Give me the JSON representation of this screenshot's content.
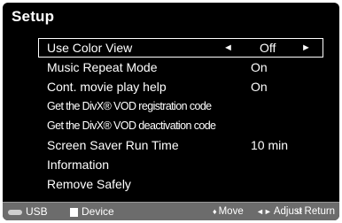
{
  "title": "Setup",
  "menu": [
    {
      "label": "Use Color View",
      "value": "Off"
    },
    {
      "label": "Music Repeat Mode",
      "value": "On"
    },
    {
      "label": "Cont. movie play help",
      "value": "On"
    },
    {
      "label": "Get the DivX® VOD registration code",
      "value": ""
    },
    {
      "label": "Get the DivX® VOD deactivation code",
      "value": ""
    },
    {
      "label": "Screen Saver Run Time",
      "value": "10 min"
    },
    {
      "label": "Information",
      "value": ""
    },
    {
      "label": "Remove Safely",
      "value": ""
    }
  ],
  "arrows": {
    "left": "◄",
    "right": "►"
  },
  "bottom_bar": {
    "sources": [
      "USB",
      "Device"
    ],
    "help": {
      "move_symbol": "♦",
      "move": "Move",
      "adjust_symbol": "◄►",
      "adjust": "Adjust",
      "return_symbol": "↺",
      "return": "Return"
    }
  }
}
